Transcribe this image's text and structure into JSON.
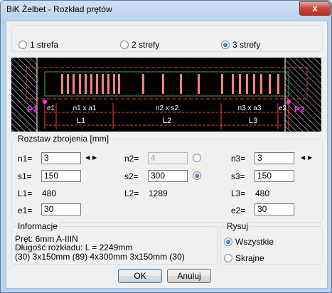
{
  "window": {
    "title": "BiK Żelbet - Rozkład prętów",
    "close_glyph": "x"
  },
  "zones": {
    "options": [
      "1 strefa",
      "2 strefy",
      "3 strefy"
    ],
    "selected": "3 strefy"
  },
  "diagram": {
    "labels": {
      "p1": "P1",
      "p2": "P2",
      "e1": "e1",
      "e2": "e2",
      "n1a1": "n1 x a1",
      "n2s2": "n2 x s2",
      "n3a3": "n3 x a3",
      "L1": "L1",
      "L2": "L2",
      "L3": "L3"
    },
    "colors": {
      "background": "#000000",
      "beam_outline": "#ff4040",
      "inner_outline": "#3fa85c",
      "bars": "#ff8080",
      "dims": "#ff3b3b",
      "text": "#ffffff",
      "points": "#ff30ff",
      "hatch": "#ffffff"
    }
  },
  "spacing": {
    "title": "Rozstaw zbrojenia [mm]",
    "n1_label": "n1=",
    "n1": "3",
    "s1_label": "s1=",
    "s1": "150",
    "L1_label": "L1=",
    "L1": "480",
    "e1_label": "e1=",
    "e1": "30",
    "n2_label": "n2=",
    "n2": "4",
    "s2_label": "s2=",
    "s2": "300",
    "L2_label": "L2=",
    "L2": "1289",
    "n3_label": "n3=",
    "n3": "3",
    "s3_label": "s3=",
    "s3": "150",
    "L3_label": "L3=",
    "L3": "480",
    "e2_label": "e2=",
    "e2": "30",
    "n2_radio_checked": false,
    "s2_radio_checked": true,
    "spin_glyphs": {
      "left": "◀",
      "right": "▶"
    }
  },
  "info": {
    "title": "Informacje",
    "line1": "Pręt:   6mm   A-IIIN",
    "line2": "Długość rozkładu:   L = 2249mm",
    "line3": "(30) 3x150mm     (89) 4x300mm      3x150mm (30)"
  },
  "draw": {
    "title": "Rysuj",
    "options": [
      "Wszystkie",
      "Skrajne"
    ],
    "selected": "Wszystkie"
  },
  "buttons": {
    "ok": "OK",
    "cancel": "Anuluj"
  }
}
